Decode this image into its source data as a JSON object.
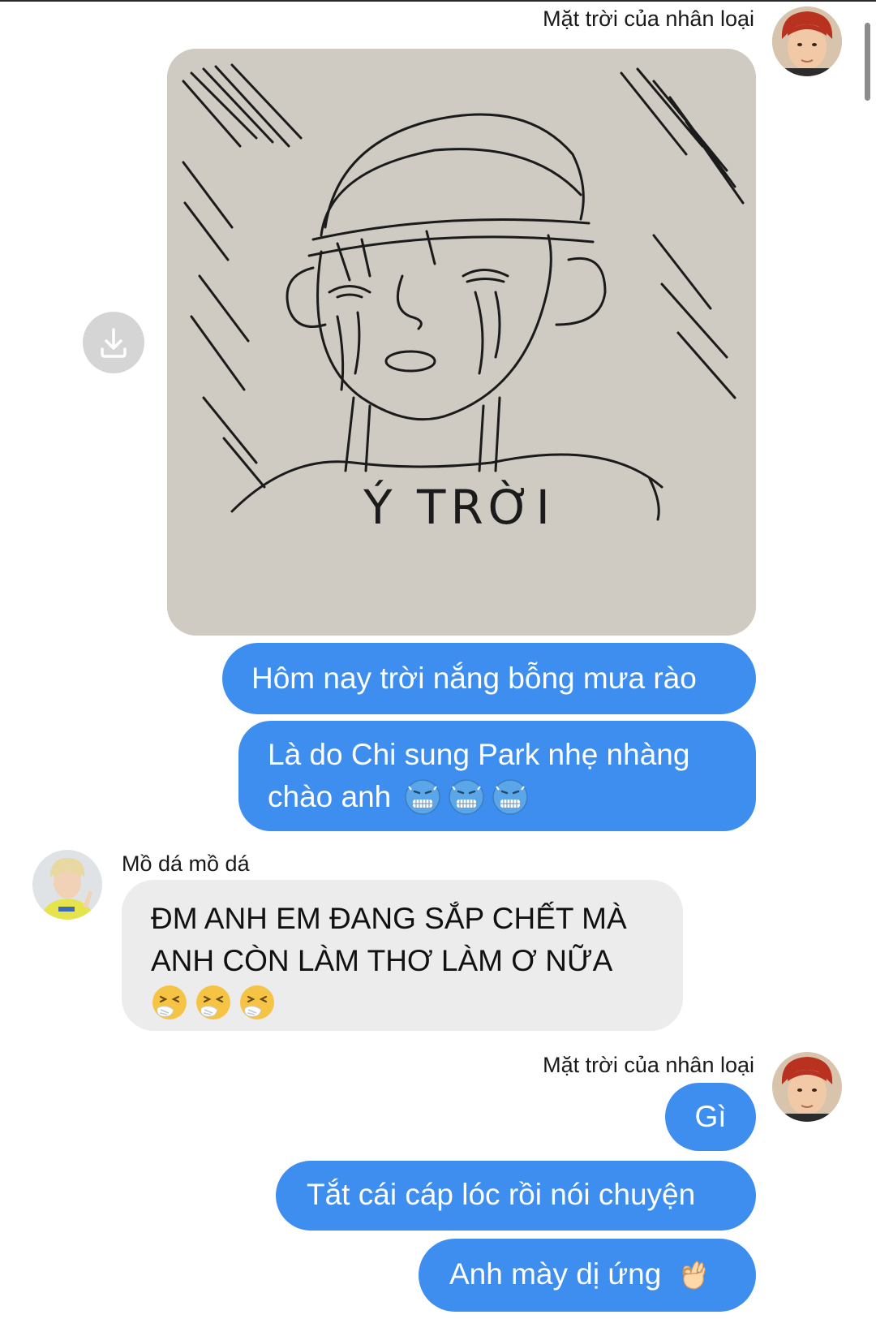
{
  "chat": {
    "sender_me": "Mặt trời của nhân loại",
    "sender_other": "Mồ dá mồ dá",
    "messages_group1": [
      "Hôm nay trời nắng bỗng mưa rào",
      "Là do Chi sung Park nhẹ nhàng",
      "chào anh"
    ],
    "other_line1": "ĐM ANH EM ĐANG SẮP CHẾT MÀ",
    "other_line2": "ANH CÒN LÀM THƠ LÀM Ơ NỮA",
    "messages_group2": [
      "Gì",
      "Tắt cái cáp lóc rồi nói chuyện",
      "Anh mày dị ứng"
    ]
  },
  "image": {
    "sketch_caption": "Ý TRỜI"
  },
  "icons": {
    "download": "download-icon",
    "cold_face": "cold-face-emoji",
    "sneezing_face": "sneezing-face-emoji",
    "ok_hand": "ok-hand-emoji"
  },
  "colors": {
    "outgoing_bubble": "#3e8ef0",
    "incoming_bubble": "#ececec"
  }
}
